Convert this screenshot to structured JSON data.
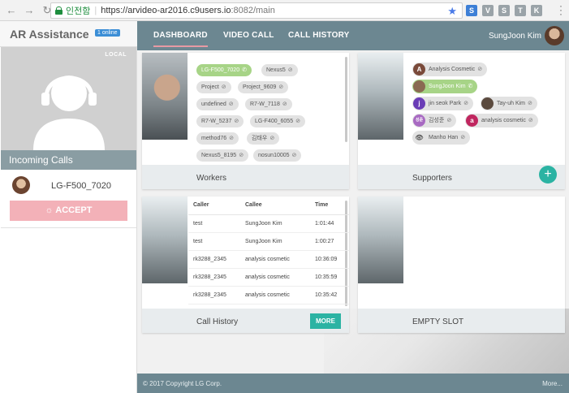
{
  "browser": {
    "secure_label": "인전함",
    "url_host": "https://arvideo-ar2016.c9users.io",
    "url_path": ":8082/main",
    "back_icon": "arrow-left-icon",
    "forward_icon": "arrow-right-icon",
    "reload_icon": "reload-icon",
    "star_icon": "star-icon",
    "menu_icon": "kebab-menu-icon"
  },
  "brand": {
    "title": "AR Assistance",
    "online_badge": "1 online"
  },
  "nav": {
    "tabs": [
      {
        "label": "DASHBOARD",
        "active": true
      },
      {
        "label": "VIDEO CALL",
        "active": false
      },
      {
        "label": "CALL HISTORY",
        "active": false
      }
    ],
    "user_name": "SungJoon Kim"
  },
  "sidebar": {
    "local_label": "LOCAL",
    "incoming_title": "Incoming Calls",
    "incoming_caller": "LG-F500_7020",
    "accept_label": "ACCEPT"
  },
  "workers": {
    "title": "Workers",
    "chips": [
      {
        "label": "LG-F500_7020",
        "online": true
      },
      {
        "label": "Nexus5",
        "online": false
      },
      {
        "label": "Project",
        "online": false
      },
      {
        "label": "Project_9609",
        "online": false
      },
      {
        "label": "undefined",
        "online": false
      },
      {
        "label": "R7-W_7118",
        "online": false
      },
      {
        "label": "R7-W_5237",
        "online": false
      },
      {
        "label": "LG-F400_6055",
        "online": false
      },
      {
        "label": "method76",
        "online": false
      },
      {
        "label": "김태우",
        "online": false
      },
      {
        "label": "Nexus5_8195",
        "online": false
      },
      {
        "label": "nosun10005",
        "online": false
      }
    ]
  },
  "supporters": {
    "title": "Supporters",
    "add_label": "+",
    "chips": [
      {
        "label": "Analysis Cosmetic",
        "avatar": "A",
        "avatar_color": "#7a4a3a",
        "online": false
      },
      {
        "label": "SungJoon Kim",
        "avatar": "",
        "avatar_color": "#8a6a52",
        "online": true
      },
      {
        "label": "jin seok Park",
        "avatar": "j",
        "avatar_color": "#6a3db6",
        "online": false
      },
      {
        "label": "Tay-uh Kim",
        "avatar": "",
        "avatar_color": "#5b4a3e",
        "online": false
      },
      {
        "label": "김성준",
        "avatar": "성준",
        "avatar_color": "#a86ac2",
        "online": false
      },
      {
        "label": "analysis cosmetic",
        "avatar": "a",
        "avatar_color": "#c0265f",
        "online": false
      },
      {
        "label": "Manho Han",
        "avatar": "",
        "avatar_color": "#666666",
        "online": false
      }
    ]
  },
  "call_history": {
    "title": "Call History",
    "more_label": "MORE",
    "columns": [
      "Caller",
      "Callee",
      "Time"
    ],
    "rows": [
      [
        "test",
        "SungJoon Kim",
        "1:01:44"
      ],
      [
        "test",
        "SungJoon Kim",
        "1:00:27"
      ],
      [
        "rk3288_2345",
        "analysis cosmetic",
        "10:36:09"
      ],
      [
        "rk3288_2345",
        "analysis cosmetic",
        "10:35:59"
      ],
      [
        "rk3288_2345",
        "analysis cosmetic",
        "10:35:42"
      ]
    ]
  },
  "empty_slot": {
    "title": "EMPTY SLOT"
  },
  "footer": {
    "copyright": "© 2017 Copyright LG Corp.",
    "more_label": "More..."
  },
  "colors": {
    "header": "#6c8791",
    "accent_teal": "#2bb3a3",
    "accept_pink": "#f3b1b8",
    "online_green": "#a7d487"
  }
}
